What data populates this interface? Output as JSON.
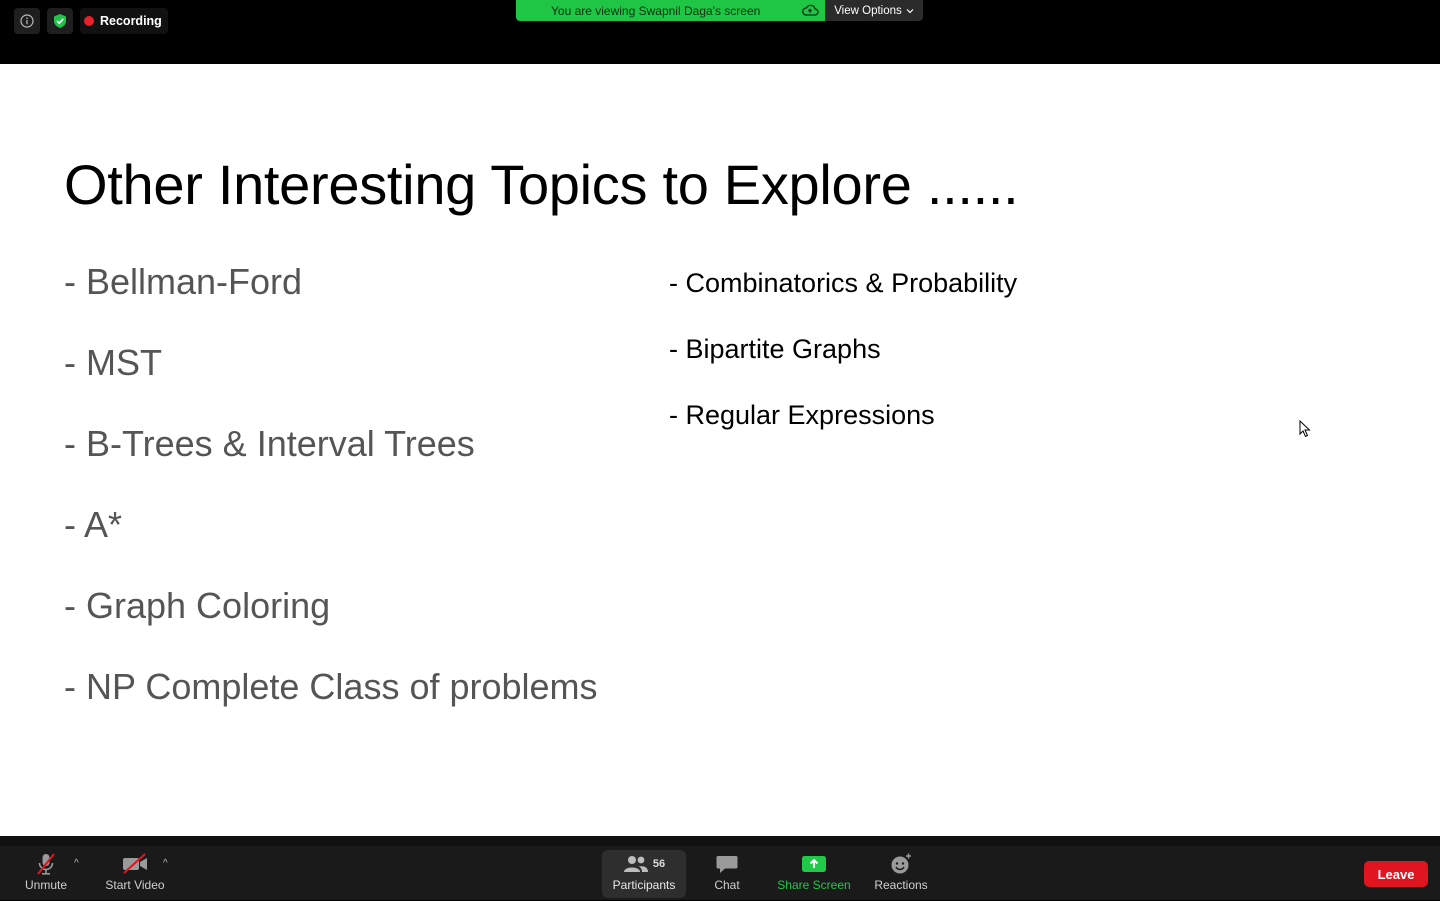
{
  "top_bar": {
    "recording_label": "Recording",
    "share_banner": "You are viewing Swapnil Daga's screen",
    "view_options_label": "View Options"
  },
  "slide": {
    "title": "Other Interesting Topics to Explore ......",
    "left_items": [
      "- Bellman-Ford",
      "- MST",
      "- B-Trees & Interval Trees",
      "- A*",
      "- Graph Coloring",
      "- NP Complete Class of problems"
    ],
    "right_items": [
      "- Combinatorics & Probability",
      "- Bipartite Graphs",
      "- Regular Expressions"
    ]
  },
  "toolbar": {
    "unmute_label": "Unmute",
    "start_video_label": "Start Video",
    "participants_label": "Participants",
    "participants_count": "56",
    "chat_label": "Chat",
    "share_screen_label": "Share Screen",
    "reactions_label": "Reactions",
    "leave_label": "Leave"
  },
  "colors": {
    "share_green": "#1fc545",
    "leave_red": "#e0151f",
    "recording_red": "#e8202a"
  }
}
